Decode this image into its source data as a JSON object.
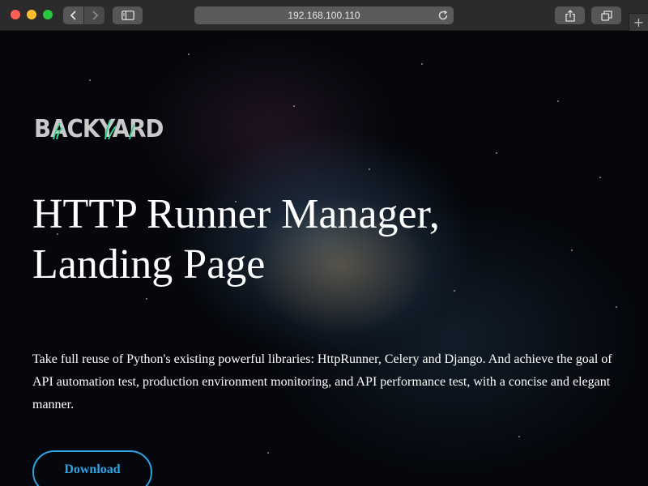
{
  "browser": {
    "url": "192.168.100.110",
    "new_tab_symbol": "+",
    "icons": [
      "back-icon",
      "forward-icon",
      "sidebar-icon",
      "reload-icon",
      "share-icon",
      "tabs-icon",
      "new-tab-icon"
    ]
  },
  "page": {
    "logo_text": "BACKYARD",
    "title_line1": "HTTP Runner Manager,",
    "title_line2": "Landing Page",
    "description": "Take full reuse of Python's existing powerful libraries: HttpRunner, Celery and Django. And achieve the goal of API automation test, production environment monitoring, and API performance test, with a concise and elegant manner.",
    "download_label": "Download"
  },
  "colors": {
    "accent": "#2ea4e6",
    "logo_grass": "#3fcf8e",
    "text": "#ffffff"
  }
}
